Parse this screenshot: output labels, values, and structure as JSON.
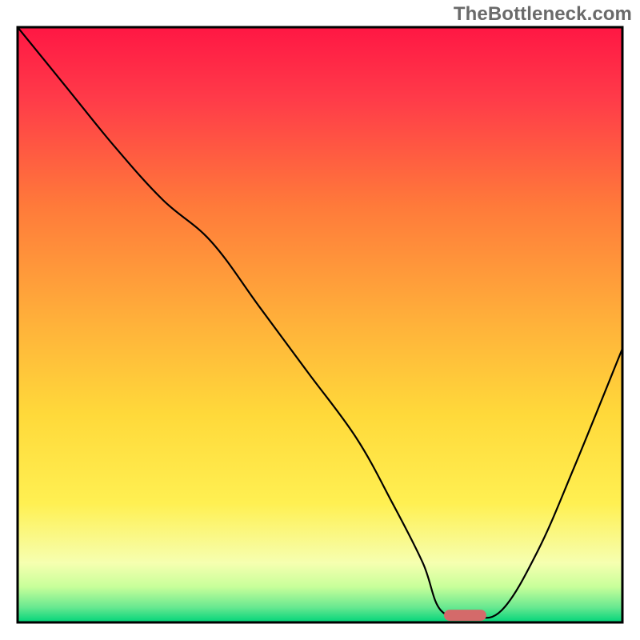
{
  "watermark": "TheBottleneck.com",
  "chart_data": {
    "type": "line",
    "title": "",
    "xlabel": "",
    "ylabel": "",
    "xlim": [
      0,
      100
    ],
    "ylim": [
      0,
      100
    ],
    "grid": false,
    "legend": false,
    "background_gradient": {
      "direction": "vertical",
      "stops": [
        {
          "offset": 0.0,
          "color": "#ff1744"
        },
        {
          "offset": 0.12,
          "color": "#ff3b49"
        },
        {
          "offset": 0.3,
          "color": "#ff7a3a"
        },
        {
          "offset": 0.5,
          "color": "#ffb23a"
        },
        {
          "offset": 0.65,
          "color": "#ffd93a"
        },
        {
          "offset": 0.8,
          "color": "#fff052"
        },
        {
          "offset": 0.9,
          "color": "#f6ffb0"
        },
        {
          "offset": 0.94,
          "color": "#c8ff9a"
        },
        {
          "offset": 0.975,
          "color": "#67e890"
        },
        {
          "offset": 1.0,
          "color": "#00d47a"
        }
      ]
    },
    "series": [
      {
        "name": "bottleneck-curve",
        "x": [
          0,
          8,
          16,
          24,
          32,
          40,
          48,
          56,
          62,
          67,
          70,
          75,
          80,
          86,
          92,
          100
        ],
        "y": [
          100,
          90,
          80,
          71,
          64,
          53,
          42,
          31,
          20,
          10,
          2,
          1,
          2,
          12,
          26,
          46
        ]
      }
    ],
    "annotations": [
      {
        "name": "sweet-spot-marker",
        "type": "capsule",
        "x_range": [
          70.5,
          77.5
        ],
        "y": 1.2,
        "color": "#d46a6a"
      }
    ]
  }
}
